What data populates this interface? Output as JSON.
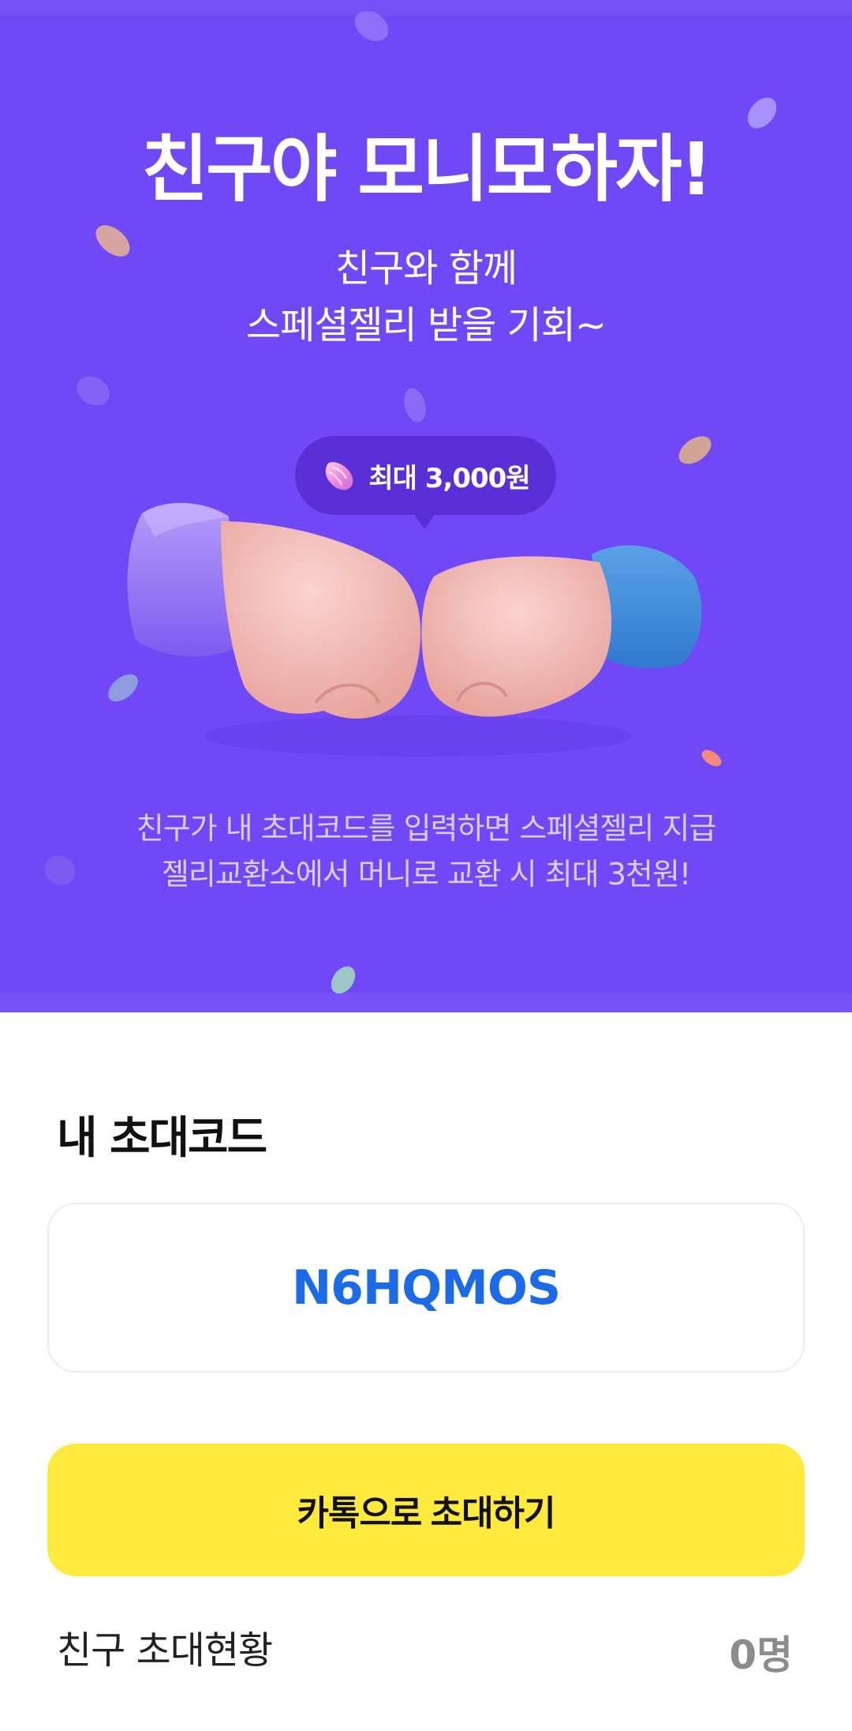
{
  "hero": {
    "title": "친구야 모니모하자!",
    "subtitle_line1": "친구와 함께",
    "subtitle_line2": "스페셜젤리 받을 기회~",
    "badge_text": "최대 3,000원",
    "desc_line1": "친구가 내 초대코드를 입력하면 스페셜젤리 지급",
    "desc_line2": "젤리교환소에서 머니로 교환 시 최대 3천원!",
    "illustration": "fist-bump-illustration",
    "colors": {
      "background": "#7048f5",
      "badge": "#5a2fd6"
    }
  },
  "invite": {
    "section_title": "내 초대코드",
    "code": "N6HQMOS",
    "code_color": "#1b6be8",
    "kakao_button_label": "카톡으로 초대하기",
    "kakao_button_color": "#fee93c"
  },
  "status": {
    "label": "친구 초대현황",
    "count": "0명"
  }
}
